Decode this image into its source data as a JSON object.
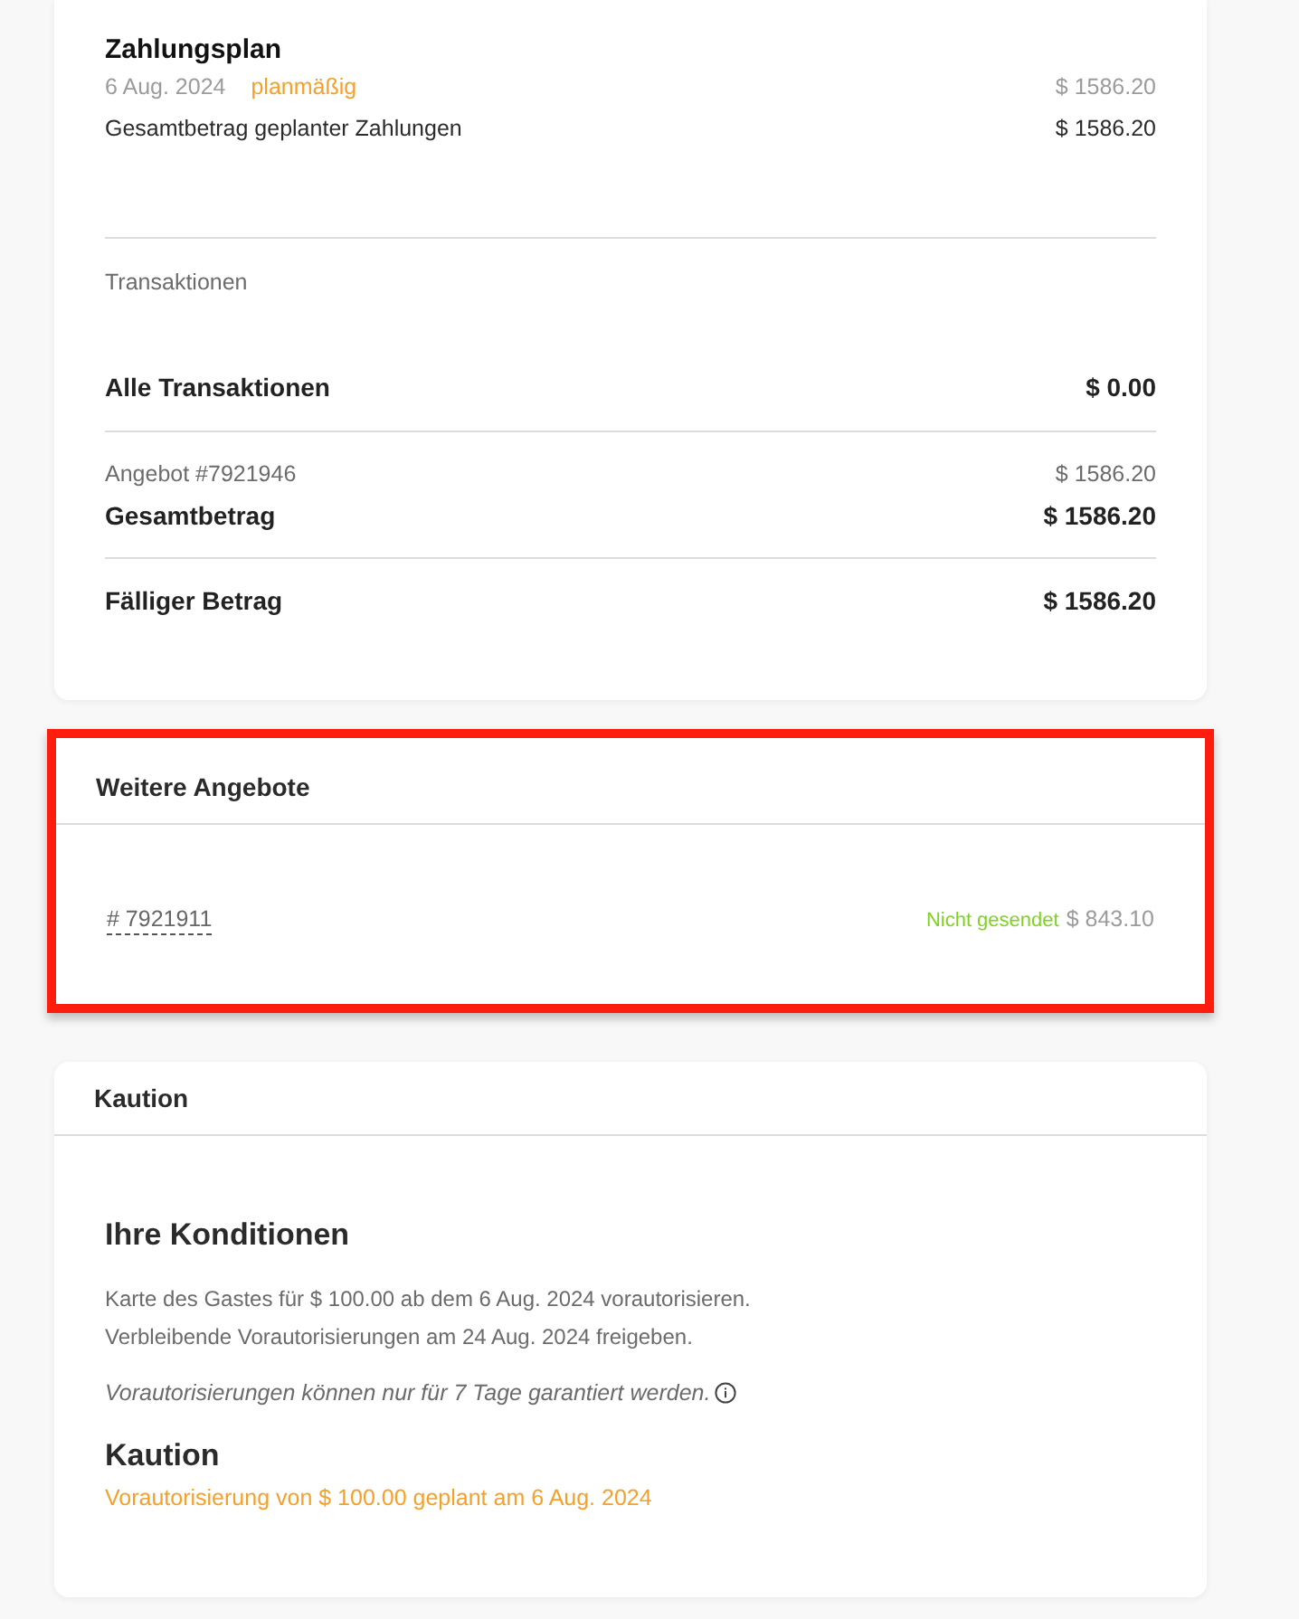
{
  "payment_plan": {
    "title": "Zahlungsplan",
    "entries": [
      {
        "date": "6 Aug. 2024",
        "status": "planmäßig",
        "amount": "$ 1586.20"
      }
    ],
    "total": {
      "label": "Gesamtbetrag geplanter Zahlungen",
      "amount": "$ 1586.20"
    }
  },
  "transactions": {
    "heading": "Transaktionen",
    "all": {
      "label": "Alle Transaktionen",
      "amount": "$ 0.00"
    },
    "offer": {
      "label": "Angebot #7921946",
      "amount": "$ 1586.20"
    },
    "total": {
      "label": "Gesamtbetrag",
      "amount": "$ 1586.20"
    },
    "due": {
      "label": "Fälliger Betrag",
      "amount": "$ 1586.20"
    }
  },
  "further_offers": {
    "title": "Weitere Angebote",
    "highlighted": true,
    "offers": [
      {
        "number": "# 7921911",
        "status": "Nicht gesendet",
        "amount": "$ 843.10"
      }
    ]
  },
  "deposit": {
    "title": "Kaution",
    "conditions_title": "Ihre Konditionen",
    "lines": [
      "Karte des Gastes für $ 100.00 ab dem 6 Aug. 2024 vorautorisieren.",
      "Verbleibende Vorautorisierungen am 24 Aug. 2024 freigeben."
    ],
    "note": "Vorautorisierungen können nur für 7 Tage garantiert werden.",
    "deposit_title": "Kaution",
    "schedule": "Vorautorisierung von $ 100.00 geplant am 6 Aug. 2024"
  }
}
